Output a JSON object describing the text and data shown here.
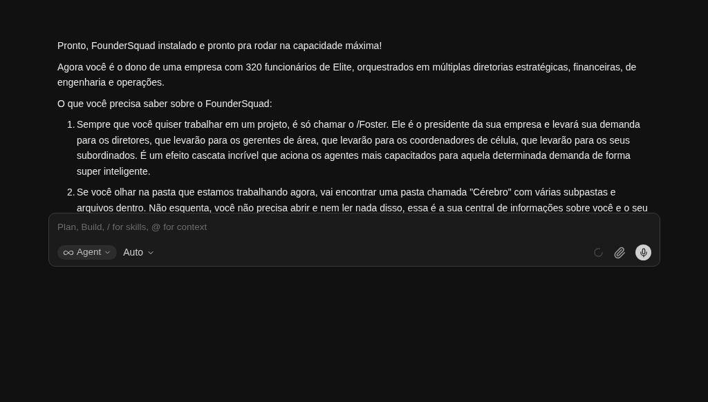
{
  "message": {
    "paragraphs": [
      "Pronto, FounderSquad instalado e pronto pra rodar na capacidade máxima!",
      "Agora você é o dono de uma empresa com 320 funcionários de Elite, orquestrados em múltiplas diretorias estratégicas, financeiras, de engenharia e operações.",
      "O que você precisa saber sobre o FounderSquad:"
    ],
    "list": [
      {
        "number": "1.",
        "text": "Sempre que você quiser trabalhar em um projeto, é só chamar o /Foster. Ele é o presidente da sua empresa e levará sua demanda para os diretores, que levarão para os gerentes de área, que levarão para os coordenadores de célula, que levarão para os seus subordinados. É um efeito cascata incrível que aciona os agentes mais capacitados para aquela determinada demanda de forma super inteligente."
      },
      {
        "number": "2.",
        "text": "Se você olhar na pasta que estamos trabalhando agora, vai encontrar uma pasta chamada \"Cérebro\" com várias subpastas e arquivos dentro. Não esquenta, você não precisa abrir e nem ler nada disso, essa é a sua central de informações sobre você e o seu"
      }
    ]
  },
  "composer": {
    "placeholder": "Plan, Build, / for skills, @ for context",
    "mode": "Agent",
    "model": "Auto",
    "loading": true
  }
}
